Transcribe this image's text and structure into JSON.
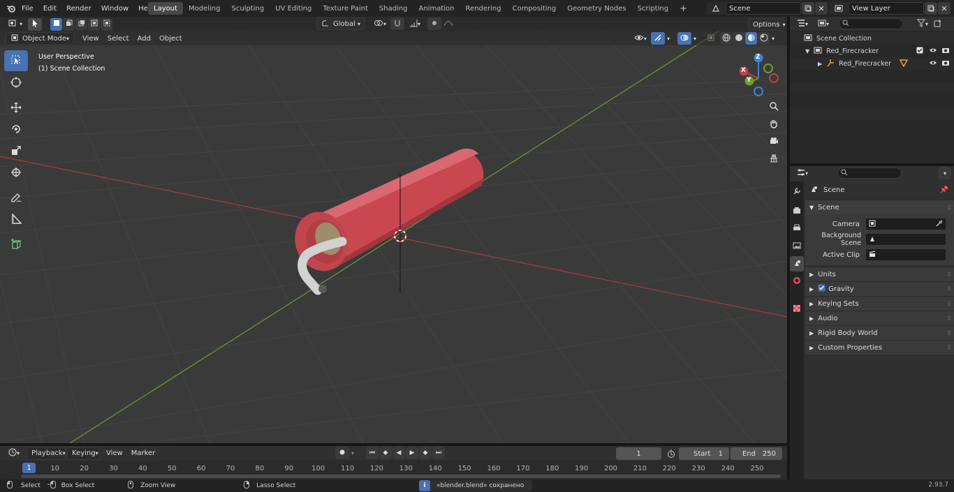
{
  "menus": [
    "File",
    "Edit",
    "Render",
    "Window",
    "Help"
  ],
  "workspaces": [
    {
      "label": "Layout",
      "active": true
    },
    {
      "label": "Modeling"
    },
    {
      "label": "Sculpting"
    },
    {
      "label": "UV Editing"
    },
    {
      "label": "Texture Paint"
    },
    {
      "label": "Shading"
    },
    {
      "label": "Animation"
    },
    {
      "label": "Rendering"
    },
    {
      "label": "Compositing"
    },
    {
      "label": "Geometry Nodes"
    },
    {
      "label": "Scripting"
    }
  ],
  "scene": {
    "name": "Scene"
  },
  "view_layer": {
    "name": "View Layer"
  },
  "header": {
    "orientation": "Global",
    "options": "Options"
  },
  "viewport_header": {
    "mode": "Object Mode",
    "menus": [
      "View",
      "Select",
      "Add",
      "Object"
    ]
  },
  "viewport": {
    "perspective": "User Perspective",
    "collection": "(1) Scene Collection"
  },
  "gizmo": {
    "z": "Z",
    "y": "Y",
    "x": "X"
  },
  "outliner": {
    "search_placeholder": "",
    "root": "Scene Collection",
    "collection": "Red_Firecracker",
    "object": "Red_Firecracker"
  },
  "properties": {
    "breadcrumb": "Scene",
    "scene_section": "Scene",
    "camera_label": "Camera",
    "bg_scene_label": "Background Scene",
    "active_clip_label": "Active Clip",
    "panels": [
      "Units",
      "Gravity",
      "Keying Sets",
      "Audio",
      "Rigid Body World",
      "Custom Properties"
    ]
  },
  "timeline": {
    "menus": [
      "Playback",
      "Keying",
      "View",
      "Marker"
    ],
    "current_frame": "1",
    "start_label": "Start",
    "start": "1",
    "end_label": "End",
    "end": "250",
    "ticks": [
      "1",
      "10",
      "20",
      "30",
      "40",
      "50",
      "60",
      "70",
      "80",
      "90",
      "100",
      "110",
      "120",
      "130",
      "140",
      "150",
      "160",
      "170",
      "180",
      "190",
      "200",
      "210",
      "220",
      "230",
      "240",
      "250"
    ]
  },
  "statusbar": {
    "select": "Select",
    "box_select": "Box Select",
    "zoom_view": "Zoom View",
    "lasso_select": "Lasso Select",
    "message": "«blender.blend» сохранено",
    "version": "2.93.7"
  },
  "colors": {
    "accent": "#4772b3",
    "x_axis": "#c43c4b",
    "y_axis": "#6d9e2c",
    "z_axis": "#3b83d9",
    "firecracker": "#c9474f"
  }
}
